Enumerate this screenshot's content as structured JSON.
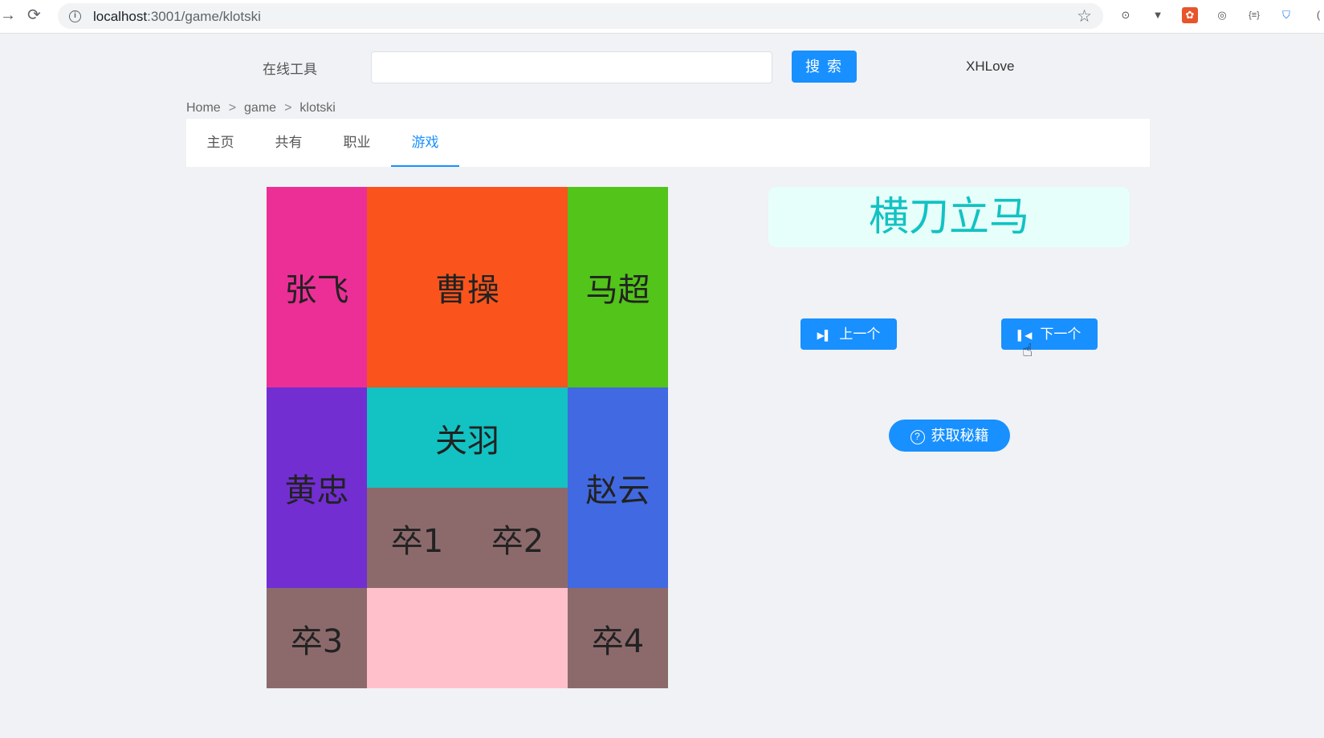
{
  "browser": {
    "url_host": "localhost",
    "url_rest": ":3001/game/klotski"
  },
  "header": {
    "site_name": "在线工具",
    "search_placeholder": "",
    "search_button": "搜 索",
    "user": "XHLove"
  },
  "breadcrumb": {
    "items": [
      "Home",
      "game",
      "klotski"
    ],
    "separator": ">"
  },
  "tabs": [
    {
      "label": "主页",
      "active": false
    },
    {
      "label": "共有",
      "active": false
    },
    {
      "label": "职业",
      "active": false
    },
    {
      "label": "游戏",
      "active": true
    }
  ],
  "board": {
    "pieces": [
      {
        "label": "张飞",
        "color": "#eb2f96"
      },
      {
        "label": "曹操",
        "color": "#fa541c"
      },
      {
        "label": "马超",
        "color": "#52c41a"
      },
      {
        "label": "黄忠",
        "color": "#722ed1"
      },
      {
        "label": "关羽",
        "color": "#13c2c2"
      },
      {
        "label": "赵云",
        "color": "#4169e1"
      },
      {
        "label": "卒1",
        "color": "#8c6a6c"
      },
      {
        "label": "卒2",
        "color": "#8c6a6c"
      },
      {
        "label": "卒3",
        "color": "#8c6a6c"
      },
      {
        "label": "卒4",
        "color": "#8c6a6c"
      },
      {
        "label": "",
        "color": "#ffc0cb"
      }
    ]
  },
  "panel": {
    "level_name": "横刀立马",
    "prev_label": "上一个",
    "next_label": "下一个",
    "hint_label": "获取秘籍"
  }
}
